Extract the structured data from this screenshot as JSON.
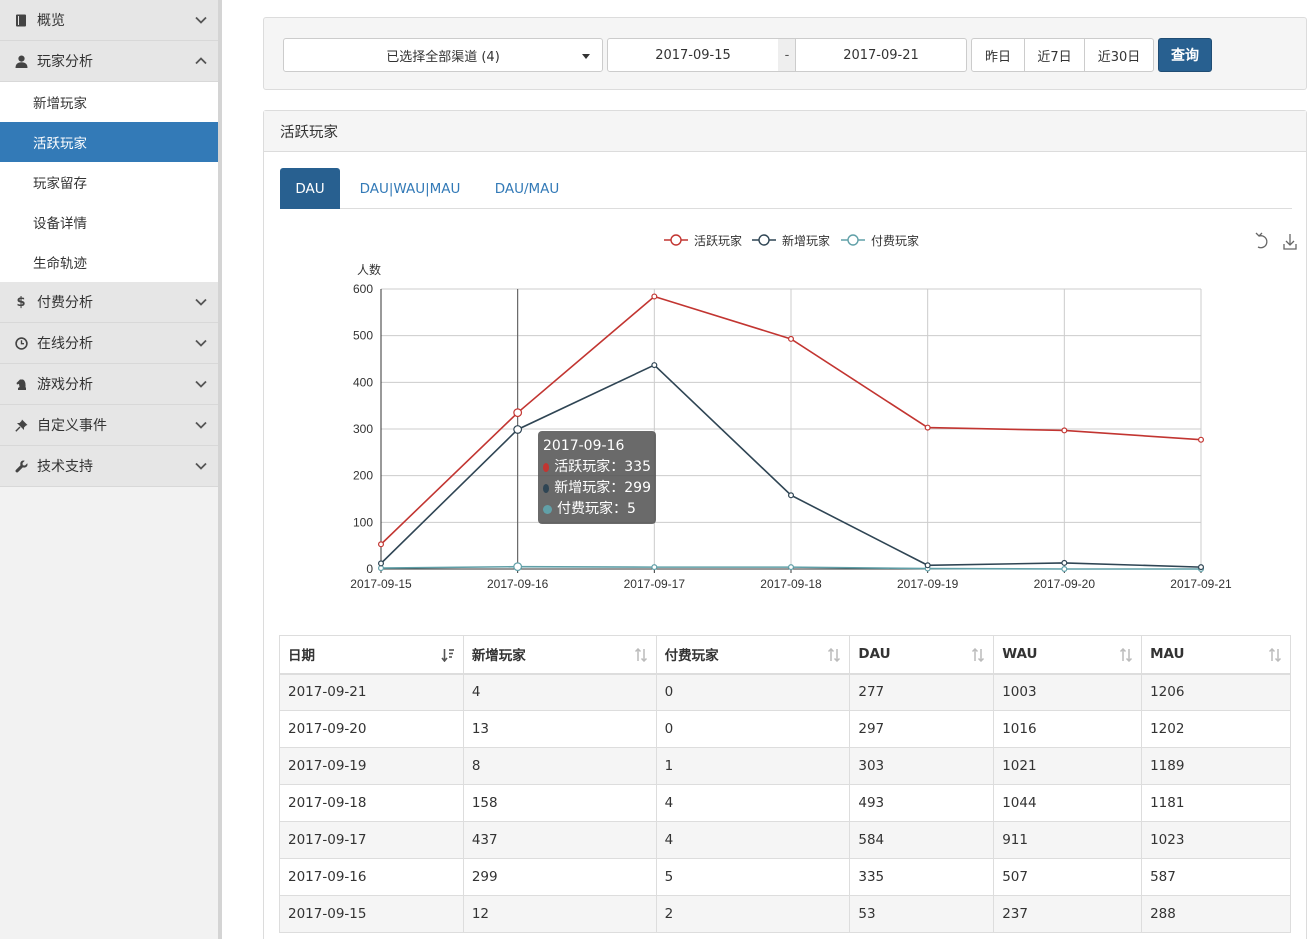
{
  "sidebar": {
    "groups": [
      {
        "label": "概览",
        "icon": "book-icon",
        "expanded": false
      },
      {
        "label": "玩家分析",
        "icon": "user-icon",
        "expanded": true,
        "items": [
          {
            "label": "新增玩家",
            "active": false
          },
          {
            "label": "活跃玩家",
            "active": true
          },
          {
            "label": "玩家留存",
            "active": false
          },
          {
            "label": "设备详情",
            "active": false
          },
          {
            "label": "生命轨迹",
            "active": false
          }
        ]
      },
      {
        "label": "付费分析",
        "icon": "dollar-icon",
        "expanded": false
      },
      {
        "label": "在线分析",
        "icon": "clock-icon",
        "expanded": false
      },
      {
        "label": "游戏分析",
        "icon": "chess-knight-icon",
        "expanded": false
      },
      {
        "label": "自定义事件",
        "icon": "pin-icon",
        "expanded": false
      },
      {
        "label": "技术支持",
        "icon": "wrench-icon",
        "expanded": false
      }
    ]
  },
  "filter": {
    "channel_select": "已选择全部渠道 (4)",
    "date_from": "2017-09-15",
    "date_separator": "-",
    "date_to": "2017-09-21",
    "quick_buttons": [
      "昨日",
      "近7日",
      "近30日"
    ],
    "query_button": "查询"
  },
  "panel": {
    "title": "活跃玩家",
    "tabs": [
      {
        "label": "DAU",
        "active": true
      },
      {
        "label": "DAU|WAU|MAU",
        "active": false
      },
      {
        "label": "DAU/MAU",
        "active": false
      }
    ]
  },
  "chart_data": {
    "type": "line",
    "ylabel": "人数",
    "ylim": [
      0,
      600
    ],
    "yticks": [
      0,
      100,
      200,
      300,
      400,
      500,
      600
    ],
    "grid": true,
    "legend_position": "top-center",
    "categories": [
      "2017-09-15",
      "2017-09-16",
      "2017-09-17",
      "2017-09-18",
      "2017-09-19",
      "2017-09-20",
      "2017-09-21"
    ],
    "series": [
      {
        "name": "活跃玩家",
        "color": "#c23531",
        "values": [
          53,
          335,
          584,
          493,
          303,
          297,
          277
        ]
      },
      {
        "name": "新增玩家",
        "color": "#2f4554",
        "values": [
          12,
          299,
          437,
          158,
          8,
          13,
          4
        ]
      },
      {
        "name": "付费玩家",
        "color": "#61a0a8",
        "values": [
          2,
          5,
          4,
          4,
          1,
          0,
          0
        ]
      }
    ],
    "tooltip": {
      "title": "2017-09-16",
      "rows": [
        {
          "text": "活跃玩家：335",
          "color": "#c23531"
        },
        {
          "text": "新增玩家：299",
          "color": "#2f4554"
        },
        {
          "text": "付费玩家：5",
          "color": "#61a0a8"
        }
      ]
    },
    "toolbox": [
      "refresh-icon",
      "download-icon"
    ]
  },
  "table": {
    "columns": [
      "日期",
      "新增玩家",
      "付费玩家",
      "DAU",
      "WAU",
      "MAU"
    ],
    "rows": [
      [
        "2017-09-21",
        "4",
        "0",
        "277",
        "1003",
        "1206"
      ],
      [
        "2017-09-20",
        "13",
        "0",
        "297",
        "1016",
        "1202"
      ],
      [
        "2017-09-19",
        "8",
        "1",
        "303",
        "1021",
        "1189"
      ],
      [
        "2017-09-18",
        "158",
        "4",
        "493",
        "1044",
        "1181"
      ],
      [
        "2017-09-17",
        "437",
        "4",
        "584",
        "911",
        "1023"
      ],
      [
        "2017-09-16",
        "299",
        "5",
        "335",
        "507",
        "587"
      ],
      [
        "2017-09-15",
        "12",
        "2",
        "53",
        "237",
        "288"
      ]
    ]
  }
}
